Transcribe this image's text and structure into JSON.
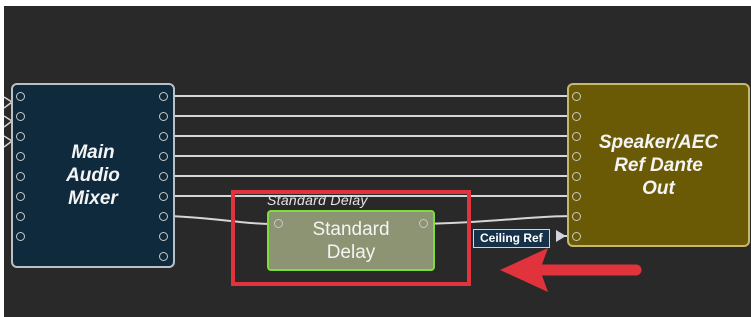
{
  "blocks": {
    "mixer": {
      "title": "Main\nAudio\nMixer",
      "fill": "#0f2a3c"
    },
    "delay": {
      "title": "Standard\nDelay",
      "caption": "Standard  Delay",
      "fill": "#8c9474",
      "border": "#7fdc3a"
    },
    "speaker": {
      "title": "Speaker/AEC\nRef Dante\nOut",
      "fill": "#6b5a05"
    }
  },
  "wire_tag": {
    "label": "Ceiling Ref"
  },
  "annotation": {
    "color": "#e0333b",
    "arrow_icon": "red-arrow-left-icon"
  }
}
